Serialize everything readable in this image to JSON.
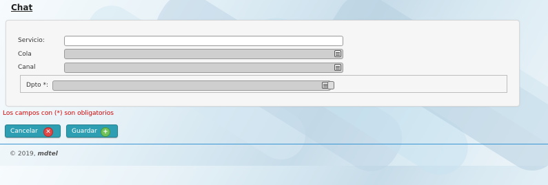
{
  "page": {
    "title": "Chat"
  },
  "form": {
    "servicio": {
      "label": "Servicio:",
      "value": ""
    },
    "cola": {
      "label": "Cola",
      "value": ""
    },
    "canal": {
      "label": "Canal",
      "value": ""
    },
    "dpto": {
      "label": "Dpto *:",
      "value": ""
    }
  },
  "required_note": "Los campos con (*) son obligatorios",
  "buttons": {
    "cancel": "Cancelar",
    "save": "Guardar"
  },
  "footer": {
    "copyright": "© 2019, ",
    "brand": "mdtel"
  },
  "icons": {
    "list": "list-icon",
    "database": "database-icon",
    "cancel": "close-circle-icon",
    "save": "plus-circle-icon"
  },
  "colors": {
    "button": "#2e9fb2",
    "required": "#d60000",
    "divider": "#3b95d2"
  }
}
